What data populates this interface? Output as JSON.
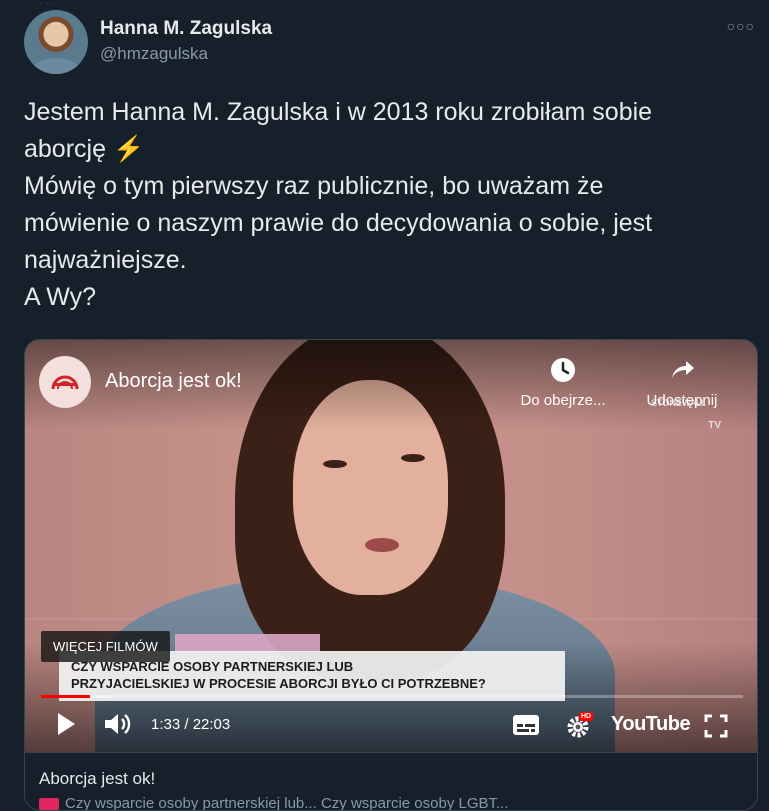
{
  "author": {
    "name": "Hanna M. Zagulska",
    "handle": "@hmzagulska"
  },
  "tweet": {
    "lines": [
      "Jestem Hanna M. Zagulska i w 2013 roku zrobiłam sobie",
      "aborcję",
      "Mówię o tym pierwszy raz publicznie, bo uważam że",
      "mówienie o naszym prawie do decydowania o sobie, jest",
      "najważniejsze.",
      "A Wy?"
    ]
  },
  "video": {
    "title": "Aborcja jest ok!",
    "channel_logo_text": "STONEWALL TV",
    "watch_later_label": "Do obejrze...",
    "share_label": "Udostępnij",
    "more_films_label": "WIĘCEJ FILMÓW",
    "caption_line1": "CZY WSPARCIE OSOBY PARTNERSKIEJ LUB",
    "caption_line2": "PRZYJACIELSKIEJ W PROCESIE ABORCJI BYŁO CI POTRZEBNE?",
    "current_time": "1:33",
    "duration": "22:03",
    "time_display": "1:33 / 22:03",
    "played_fraction": 0.07,
    "loaded_fraction": 0.1,
    "hd_badge": "HD",
    "youtube_label": "YouTube",
    "watermark_text": "STONEWALL",
    "watermark_tv": "TV"
  },
  "card": {
    "title": "Aborcja jest ok!",
    "description": "Czy wsparcie osoby partnerskiej lub...  Czy wsparcie osoby LGBT..."
  },
  "colors": {
    "background": "#15202b",
    "accent_red": "#ff0000",
    "bolt": "#f5b700"
  }
}
